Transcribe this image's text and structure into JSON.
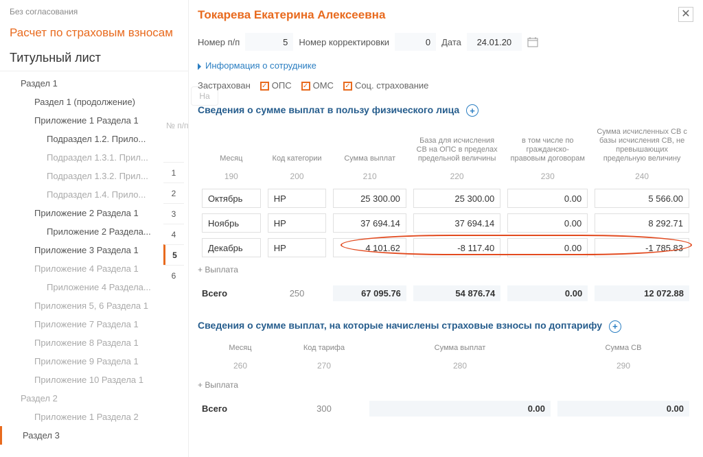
{
  "sidebar": {
    "status": "Без согласования",
    "title": "Расчет по страховым взносам",
    "subtitle": "Титульный лист",
    "items": [
      {
        "label": "Раздел 1",
        "depth": 1
      },
      {
        "label": "Раздел 1 (продолжение)",
        "depth": 2
      },
      {
        "label": "Приложение 1 Раздела 1",
        "depth": 2
      },
      {
        "label": "Подраздел 1.2. Прило...",
        "depth": 3
      },
      {
        "label": "Подраздел 1.3.1. Прил...",
        "depth": 3,
        "faded": true
      },
      {
        "label": "Подраздел 1.3.2. Прил...",
        "depth": 3,
        "faded": true
      },
      {
        "label": "Подраздел 1.4. Прило...",
        "depth": 3,
        "faded": true
      },
      {
        "label": "Приложение 2 Раздела 1",
        "depth": 2
      },
      {
        "label": "Приложение 2 Раздела...",
        "depth": 3
      },
      {
        "label": "Приложение 3 Раздела 1",
        "depth": 2
      },
      {
        "label": "Приложение 4 Раздела 1",
        "depth": 2,
        "faded": true
      },
      {
        "label": "Приложение 4 Раздела...",
        "depth": 3,
        "faded": true
      },
      {
        "label": "Приложения 5, 6 Раздела 1",
        "depth": 2,
        "faded": true
      },
      {
        "label": "Приложение 7 Раздела 1",
        "depth": 2,
        "faded": true
      },
      {
        "label": "Приложение 8 Раздела 1",
        "depth": 2,
        "faded": true
      },
      {
        "label": "Приложение 9 Раздела 1",
        "depth": 2,
        "faded": true
      },
      {
        "label": "Приложение 10 Раздела 1",
        "depth": 2,
        "faded": true
      },
      {
        "label": "Раздел 2",
        "depth": 1,
        "faded": true
      },
      {
        "label": "Приложение 1 Раздела 2",
        "depth": 2,
        "faded": true
      },
      {
        "label": "Раздел 3",
        "depth": 1,
        "active": true
      }
    ]
  },
  "bg": {
    "na_btn": "На",
    "np_label": "№ п/п"
  },
  "header": {
    "person": "Токарева Екатерина Алексеевна",
    "num_label": "Номер п/п",
    "num_value": "5",
    "corr_label": "Номер корректировки",
    "corr_value": "0",
    "date_label": "Дата",
    "date_value": "24.01.20",
    "info_link": "Информация о сотруднике"
  },
  "insured": {
    "label": "Застрахован",
    "ops": "ОПС",
    "oms": "ОМС",
    "soc": "Соц. страхование"
  },
  "section1": {
    "title": "Сведения о сумме выплат в пользу физического лица",
    "headers": [
      "Месяц",
      "Код категории",
      "Сумма выплат",
      "База для исчисления СВ на ОПС в пределах предельной величины",
      "в том числе по гражданско-правовым договорам",
      "Сумма исчисленных СВ с базы исчисления СВ, не превышающих предельную величину"
    ],
    "codes": [
      "190",
      "200",
      "210",
      "220",
      "230",
      "240"
    ],
    "rows": [
      {
        "month": "Октябрь",
        "cat": "НР",
        "sum": "25 300.00",
        "base": "25 300.00",
        "gpd": "0.00",
        "sv": "5 566.00"
      },
      {
        "month": "Ноябрь",
        "cat": "НР",
        "sum": "37 694.14",
        "base": "37 694.14",
        "gpd": "0.00",
        "sv": "8 292.71"
      },
      {
        "month": "Декабрь",
        "cat": "НР",
        "sum": "4 101.62",
        "base": "-8 117.40",
        "gpd": "0.00",
        "sv": "-1 785.83"
      }
    ],
    "add_label": "+ Выплата",
    "total_label": "Всего",
    "total_code": "250",
    "totals": {
      "sum": "67 095.76",
      "base": "54 876.74",
      "gpd": "0.00",
      "sv": "12 072.88"
    }
  },
  "section2": {
    "title": "Сведения о сумме выплат, на которые начислены страховые взносы по доптарифу",
    "headers": [
      "Месяц",
      "Код тарифа",
      "Сумма выплат",
      "Сумма СВ"
    ],
    "codes": [
      "260",
      "270",
      "280",
      "290"
    ],
    "add_label": "+ Выплата",
    "total_label": "Всего",
    "total_code": "300",
    "totals": {
      "sum": "0.00",
      "sv": "0.00"
    }
  },
  "rownums": [
    "1",
    "2",
    "3",
    "4",
    "5",
    "6"
  ]
}
